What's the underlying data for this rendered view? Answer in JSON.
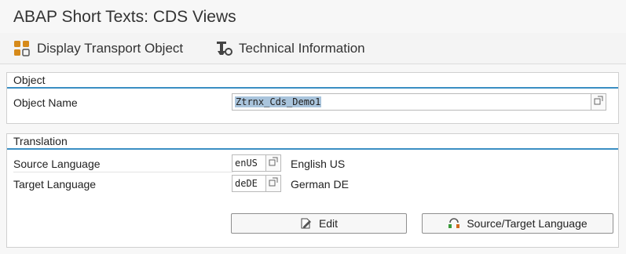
{
  "window": {
    "title": "ABAP Short Texts: CDS Views"
  },
  "toolbar": {
    "display_transport": {
      "label": "Display Transport Object",
      "icon": "transport-object-icon"
    },
    "technical_info": {
      "label": "Technical Information",
      "icon": "technical-info-icon"
    }
  },
  "object_section": {
    "header": "Object",
    "object_name": {
      "label": "Object Name",
      "value": "Ztrnx_Cds_Demo1"
    }
  },
  "translation_section": {
    "header": "Translation",
    "source_language": {
      "label": "Source Language",
      "code": "enUS",
      "description": "English US"
    },
    "target_language": {
      "label": "Target Language",
      "code": "deDE",
      "description": "German DE"
    },
    "edit_button": {
      "label": "Edit",
      "icon": "edit-icon"
    },
    "source_target_button": {
      "label": "Source/Target Language",
      "icon": "language-swap-icon"
    }
  },
  "colors": {
    "section_underline": "#3a8ec3",
    "selection": "#a9c4dc"
  }
}
